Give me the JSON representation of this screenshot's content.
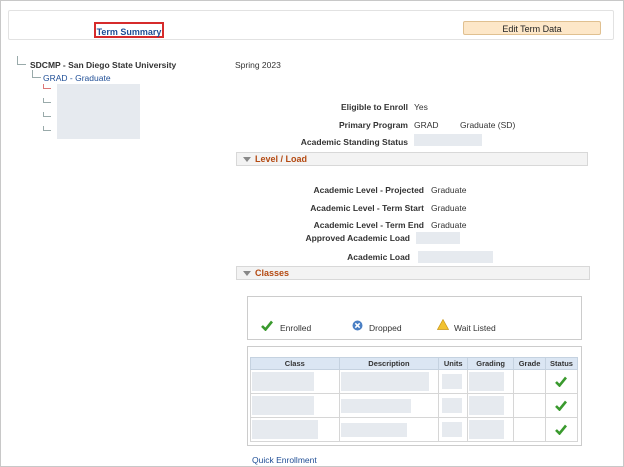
{
  "header": {
    "term_summary": "Term Summary",
    "edit_button": "Edit Term Data"
  },
  "tree": {
    "career": "SDCMP - San Diego State University",
    "program": "GRAD - Graduate"
  },
  "term": "Spring 2023",
  "summary": {
    "eligible_label": "Eligible to Enroll",
    "eligible_value": "Yes",
    "program_label": "Primary Program",
    "program_value": "GRAD",
    "program_desc": "Graduate (SD)",
    "standing_label": "Academic Standing Status"
  },
  "level_load": {
    "title": "Level / Load",
    "projected_label": "Academic Level - Projected",
    "projected_value": "Graduate",
    "start_label": "Academic Level - Term Start",
    "start_value": "Graduate",
    "end_label": "Academic Level - Term End",
    "end_value": "Graduate",
    "approved_label": "Approved Academic Load",
    "load_label": "Academic Load"
  },
  "classes": {
    "title": "Classes",
    "legend": {
      "enrolled": "Enrolled",
      "dropped": "Dropped",
      "waitlisted": "Wait Listed"
    },
    "columns": [
      "Class",
      "Description",
      "Units",
      "Grading",
      "Grade",
      "Status"
    ],
    "rows": [
      {
        "status": "enrolled"
      },
      {
        "status": "enrolled"
      },
      {
        "status": "enrolled"
      }
    ]
  },
  "footer": {
    "quick_enrollment": "Quick Enrollment"
  },
  "colors": {
    "accent": "#b44a12",
    "link": "#1f4e96",
    "enrolled": "#3a9a2e"
  }
}
